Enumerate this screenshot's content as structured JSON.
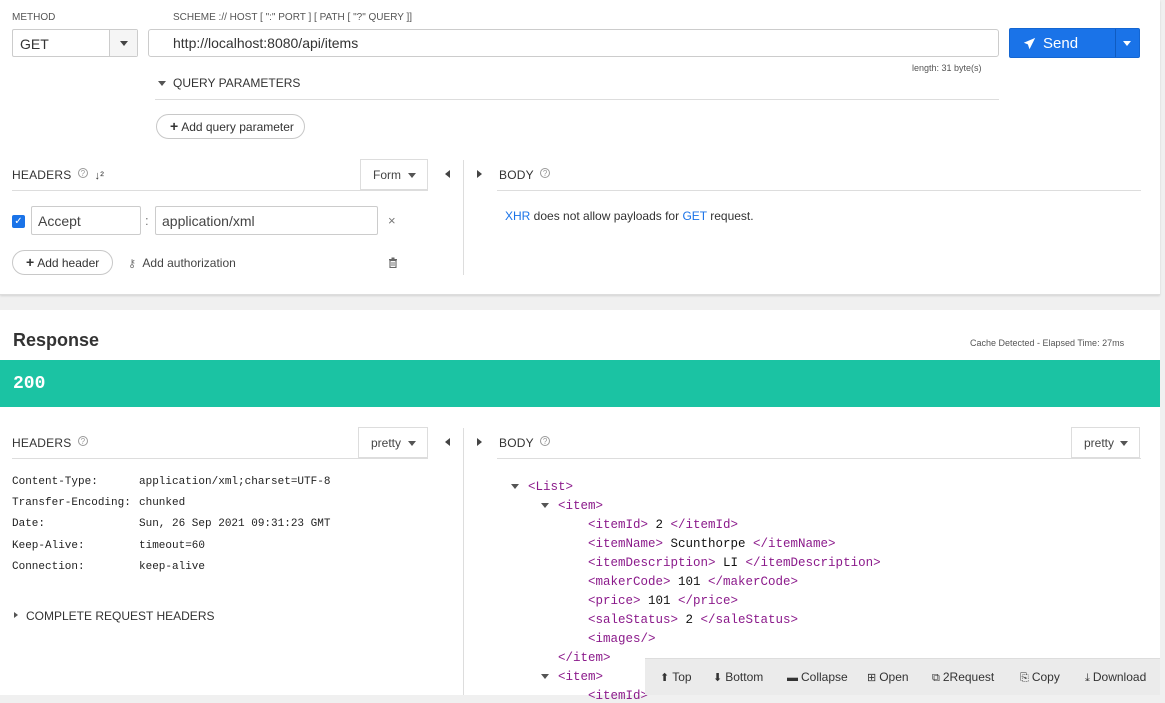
{
  "request": {
    "method_label": "METHOD",
    "method_value": "GET",
    "url_label": "SCHEME :// HOST [ \":\" PORT ] [ PATH [ \"?\" QUERY ]]",
    "url_value": "http://localhost:8080/api/items",
    "length_text": "length: 31 byte(s)",
    "send_label": "Send",
    "query_params_label": "QUERY PARAMETERS",
    "add_query_param_label": "Add query parameter",
    "headers_title": "HEADERS",
    "headers_mode": "Form",
    "header_rows": [
      {
        "enabled": true,
        "name": "Accept",
        "value": "application/xml"
      }
    ],
    "add_header_label": "Add header",
    "add_authorization_label": "Add authorization",
    "body_title": "BODY",
    "body_message": {
      "xhr": "XHR",
      "middle": " does not allow payloads for ",
      "get": "GET",
      "end": " request."
    }
  },
  "response": {
    "title": "Response",
    "meta": "Cache Detected - Elapsed Time: 27ms",
    "status_code": "200",
    "status_color": "#1bc3a3",
    "headers_title": "HEADERS",
    "headers_view": "pretty",
    "headers": [
      {
        "key": "Content-Type:",
        "value": "application/xml;charset=UTF-8"
      },
      {
        "key": "Transfer-Encoding:",
        "value": "chunked"
      },
      {
        "key": "Date:",
        "value": "Sun, 26 Sep 2021 09:31:23 GMT"
      },
      {
        "key": "Keep-Alive:",
        "value": "timeout=60"
      },
      {
        "key": "Connection:",
        "value": "keep-alive"
      }
    ],
    "complete_request_headers_label": "COMPLETE REQUEST HEADERS",
    "body_title": "BODY",
    "body_view": "pretty",
    "xml": {
      "list_open": "<List>",
      "item_open": "<item>",
      "fields": [
        {
          "open": "<itemId>",
          "value": " 2 ",
          "close": "</itemId>"
        },
        {
          "open": "<itemName>",
          "value": " Scunthorpe ",
          "close": "</itemName>"
        },
        {
          "open": "<itemDescription>",
          "value": " LI ",
          "close": "</itemDescription>"
        },
        {
          "open": "<makerCode>",
          "value": " 101 ",
          "close": "</makerCode>"
        },
        {
          "open": "<price>",
          "value": " 101 ",
          "close": "</price>"
        },
        {
          "open": "<saleStatus>",
          "value": " 2 ",
          "close": "</saleStatus>"
        },
        {
          "open": "<images/>",
          "value": "",
          "close": ""
        }
      ],
      "item_close": "</item>",
      "item_open_2": "<item>",
      "partial_next": "<itemId>"
    },
    "toolbar": {
      "top": "Top",
      "bottom": "Bottom",
      "collapse": "Collapse",
      "open": "Open",
      "to_request": "2Request",
      "copy": "Copy",
      "download": "Download"
    }
  },
  "colors": {
    "accent": "#1a73e8",
    "status_ok": "#1bc3a3",
    "xml_tag": "#8b1a8b"
  }
}
